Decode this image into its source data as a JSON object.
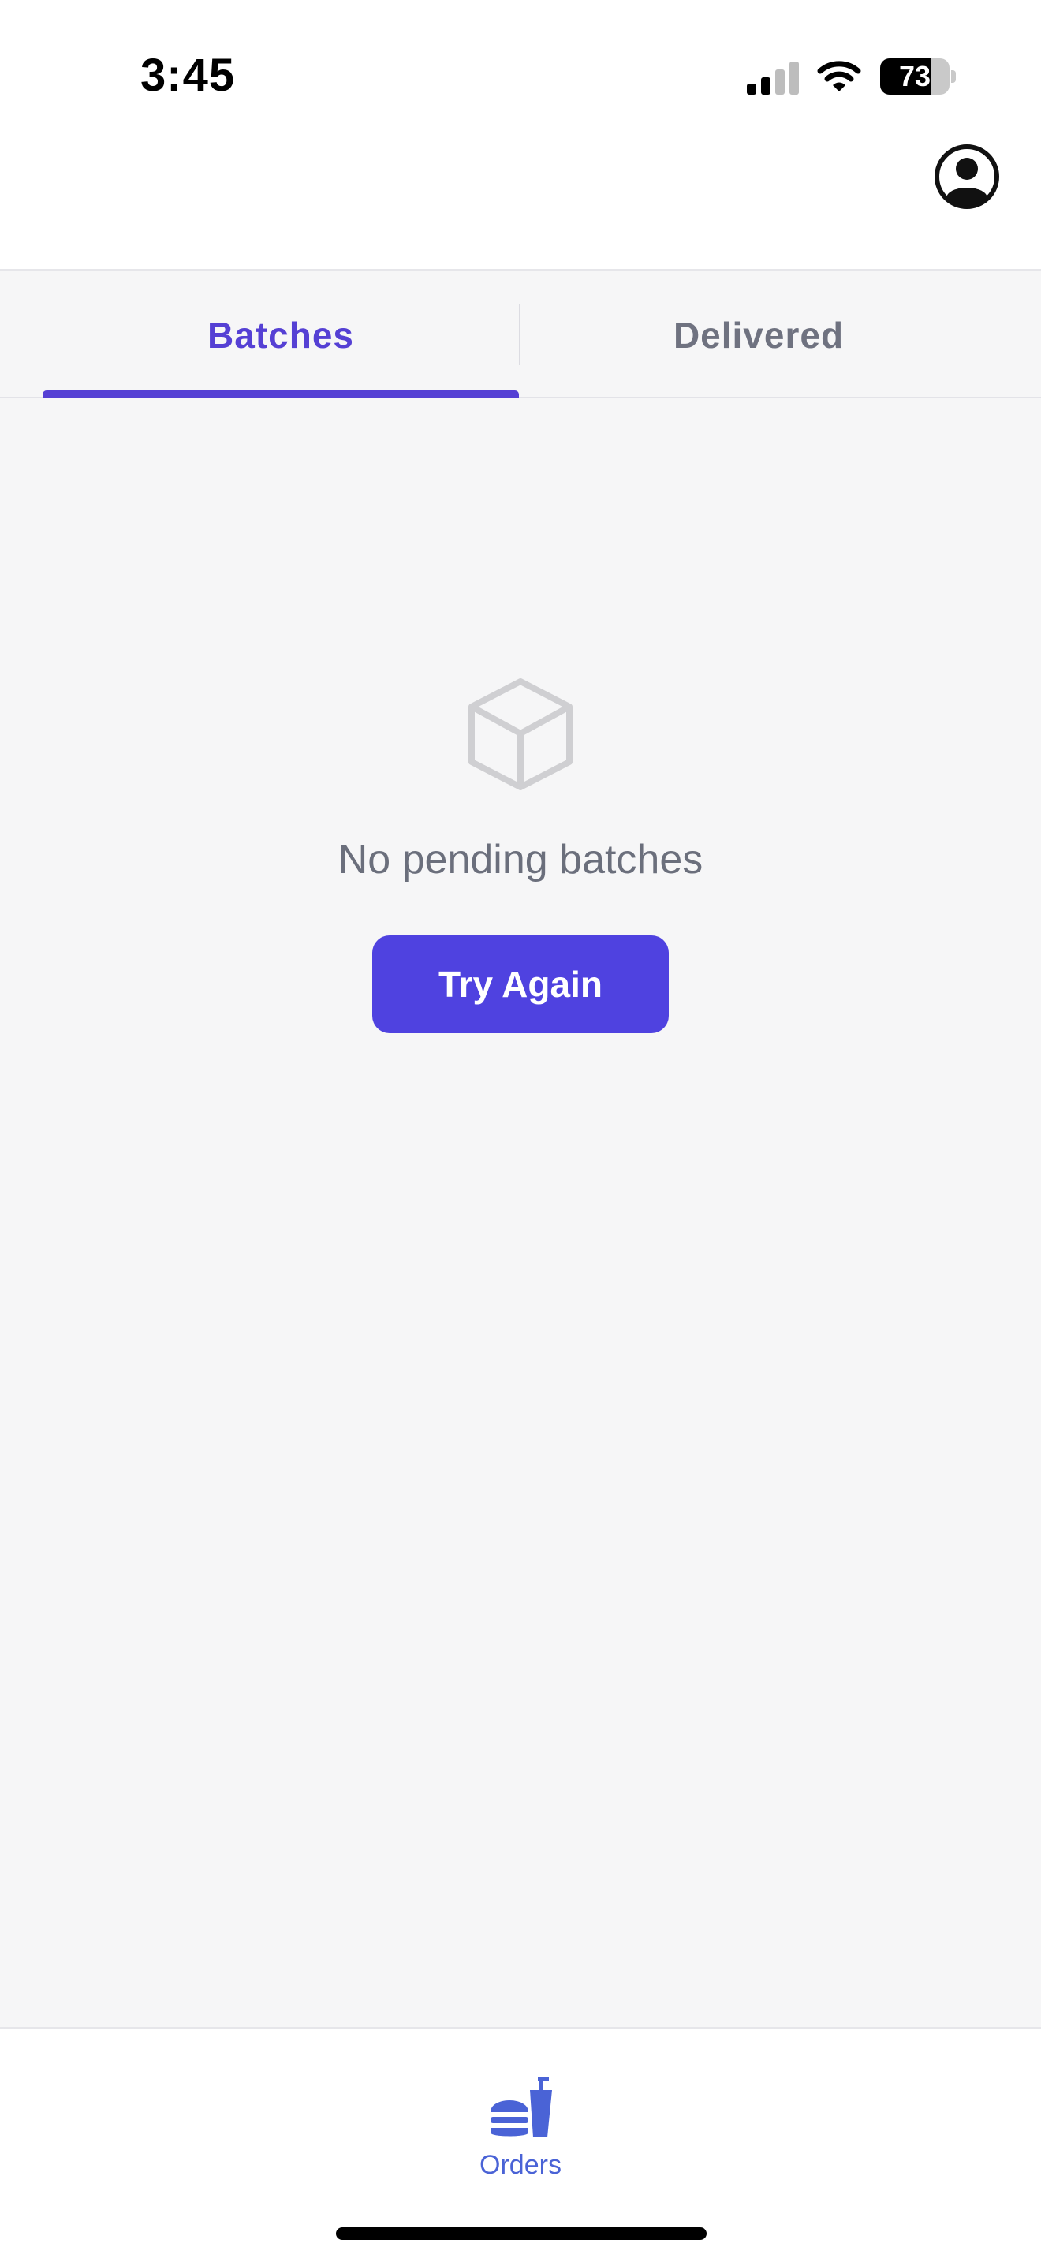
{
  "status_bar": {
    "time": "3:45",
    "battery_percent": "73",
    "battery_level": 0.73,
    "signal_bars": 2,
    "signal_icon": "cellular-signal-icon",
    "wifi_icon": "wifi-icon"
  },
  "header": {
    "profile_icon": "user-circle-icon"
  },
  "tabs": [
    {
      "label": "Batches",
      "active": true
    },
    {
      "label": "Delivered",
      "active": false
    }
  ],
  "empty_state": {
    "icon": "cube-icon",
    "message": "No pending batches",
    "button_label": "Try Again"
  },
  "bottom_nav": {
    "items": [
      {
        "label": "Orders",
        "icon": "food-icon",
        "active": true
      }
    ]
  },
  "colors": {
    "accent": "#5540d4",
    "button": "#4f42e0",
    "nav_active": "#4a63d6",
    "muted_text": "#6b6f7c"
  }
}
